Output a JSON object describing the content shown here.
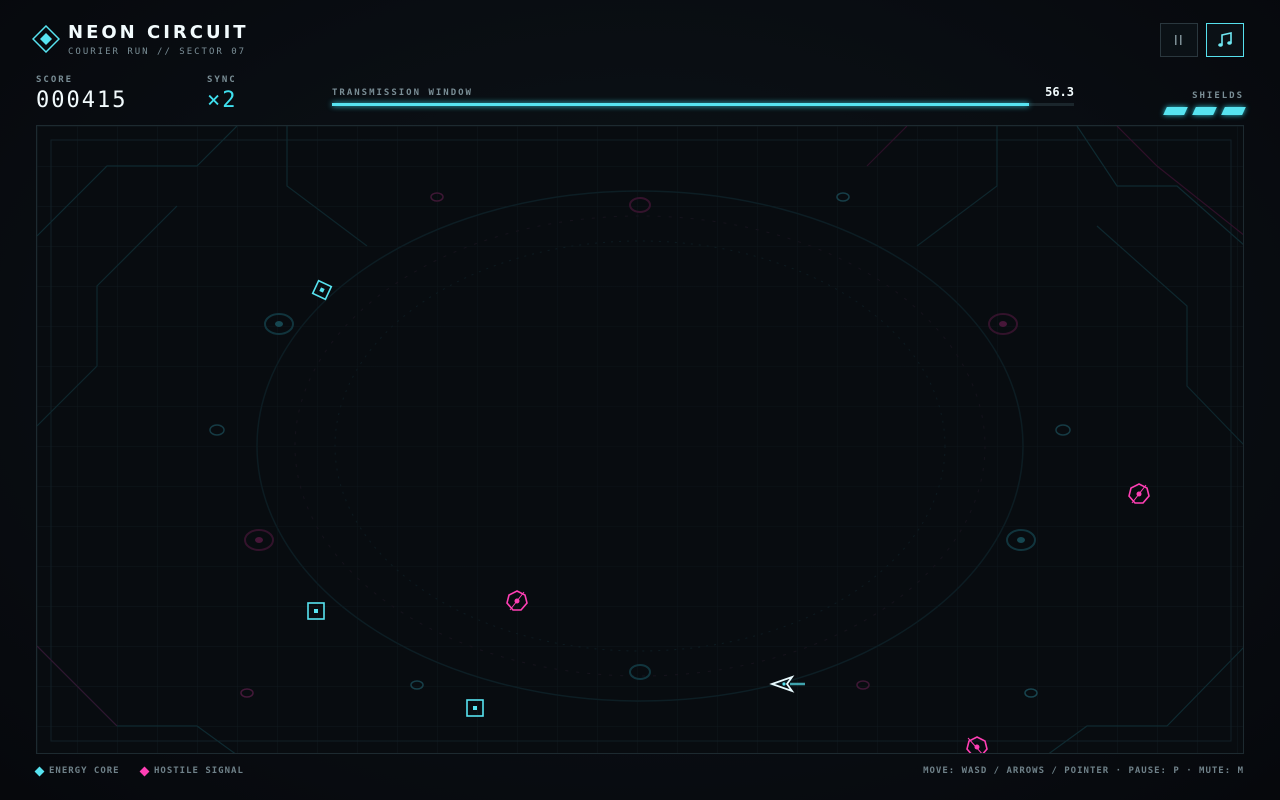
{
  "header": {
    "title": "NEON CIRCUIT",
    "subtitle": "COURIER RUN // SECTOR 07"
  },
  "stats": {
    "score_label": "SCORE",
    "score_value": "000415",
    "sync_label": "SYNC",
    "sync_value": "×2"
  },
  "transmission": {
    "label": "TRANSMISSION WINDOW",
    "value": "56.3",
    "progress": 0.94
  },
  "shields": {
    "label": "SHIELDS",
    "count": 3
  },
  "buttons": {
    "pause_icon": "pause-icon",
    "music_icon": "music-note-icon"
  },
  "legend": {
    "energy": "ENERGY CORE",
    "hostile": "HOSTILE SIGNAL"
  },
  "controls": "MOVE: WASD / ARROWS / POINTER · PAUSE: P · MUTE: M",
  "colors": {
    "accent": "#57e3f0",
    "hostile": "#ff3fb4",
    "background": "#080c10"
  }
}
